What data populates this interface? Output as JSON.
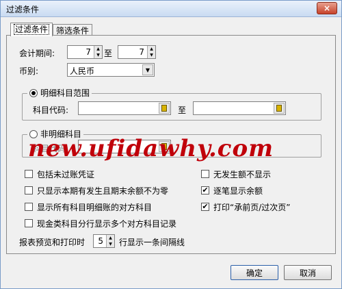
{
  "window": {
    "title": "过滤条件",
    "close_glyph": "×"
  },
  "tabs": [
    {
      "label": "过滤条件",
      "active": true
    },
    {
      "label": "筛选条件",
      "active": false
    }
  ],
  "period": {
    "label": "会计期间:",
    "from": "7",
    "to_label": "至",
    "to": "7"
  },
  "currency": {
    "label": "币别:",
    "value": "人民币",
    "dropdown_glyph": "▼"
  },
  "detail_range": {
    "legend": "明细科目范围",
    "selected": true,
    "code_label": "科目代码:",
    "to_label": "至",
    "from_value": "",
    "to_value": ""
  },
  "non_detail": {
    "legend": "非明细科目",
    "selected": false,
    "code_label": "科目代码:",
    "value": ""
  },
  "checkboxes_left": [
    {
      "label": "包括未过账凭证",
      "checked": false
    },
    {
      "label": "只显示本期有发生且期末余额不为零",
      "checked": false
    },
    {
      "label": "显示所有科目明细账的对方科目",
      "checked": false
    },
    {
      "label": "现金类科目分行显示多个对方科目记录",
      "checked": false
    }
  ],
  "checkboxes_right": [
    {
      "label": "无发生额不显示",
      "checked": false
    },
    {
      "label": "逐笔显示余额",
      "checked": true
    },
    {
      "label": "打印“承前页/过次页”",
      "checked": true
    }
  ],
  "report_line": {
    "prefix": "报表预览和打印时",
    "value": "5",
    "suffix": "行显示一条间隔线"
  },
  "buttons": {
    "ok": "确定",
    "cancel": "取消"
  },
  "watermark": "new.ufidawhy.com",
  "check_glyph": "✔",
  "spin_glyphs": {
    "up": "▲",
    "down": "▼"
  }
}
